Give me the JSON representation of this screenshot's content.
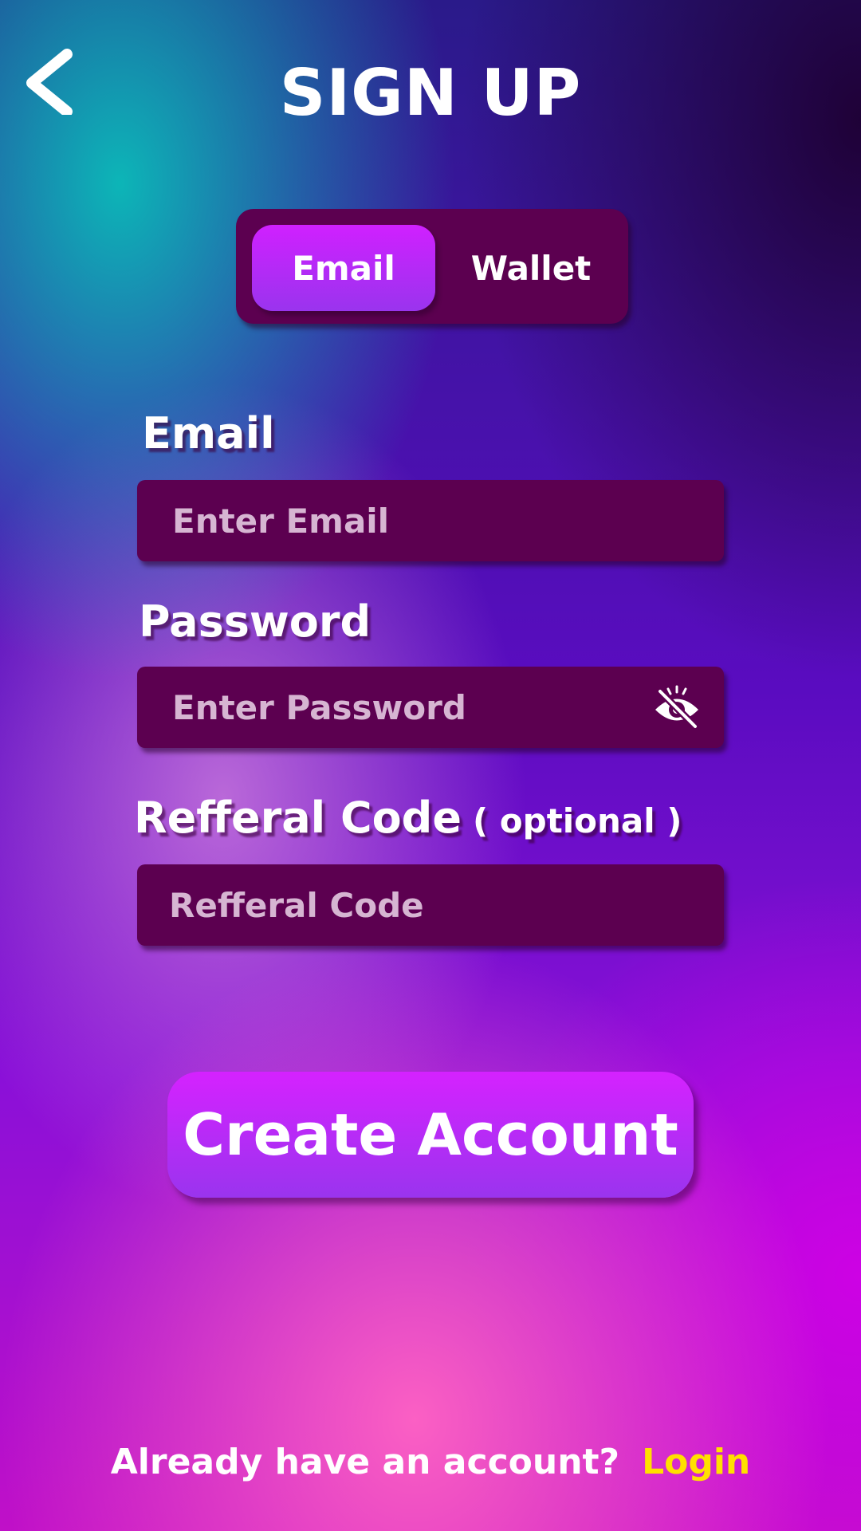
{
  "header": {
    "title": "SIGN UP",
    "back_icon": "chevron-left-icon"
  },
  "mode_toggle": {
    "options": [
      "Email",
      "Wallet"
    ],
    "selected": "Email"
  },
  "form": {
    "email": {
      "label": "Email",
      "placeholder": "Enter Email",
      "value": ""
    },
    "password": {
      "label": "Password",
      "placeholder": "Enter Password",
      "value": "",
      "visibility_icon": "eye-slash-icon"
    },
    "referral": {
      "label": "Refferal Code",
      "optional_note": "( optional )",
      "placeholder": "Refferal Code",
      "value": ""
    }
  },
  "actions": {
    "create_account_label": "Create Account"
  },
  "footer": {
    "question": "Already  have an account?",
    "login_label": "Login"
  },
  "colors": {
    "field_bg": "#5c0050",
    "button_gradient_top": "#d522ff",
    "button_gradient_bottom": "#9a34ee",
    "login_link": "#ffe000",
    "placeholder": "#d6b5d2"
  }
}
